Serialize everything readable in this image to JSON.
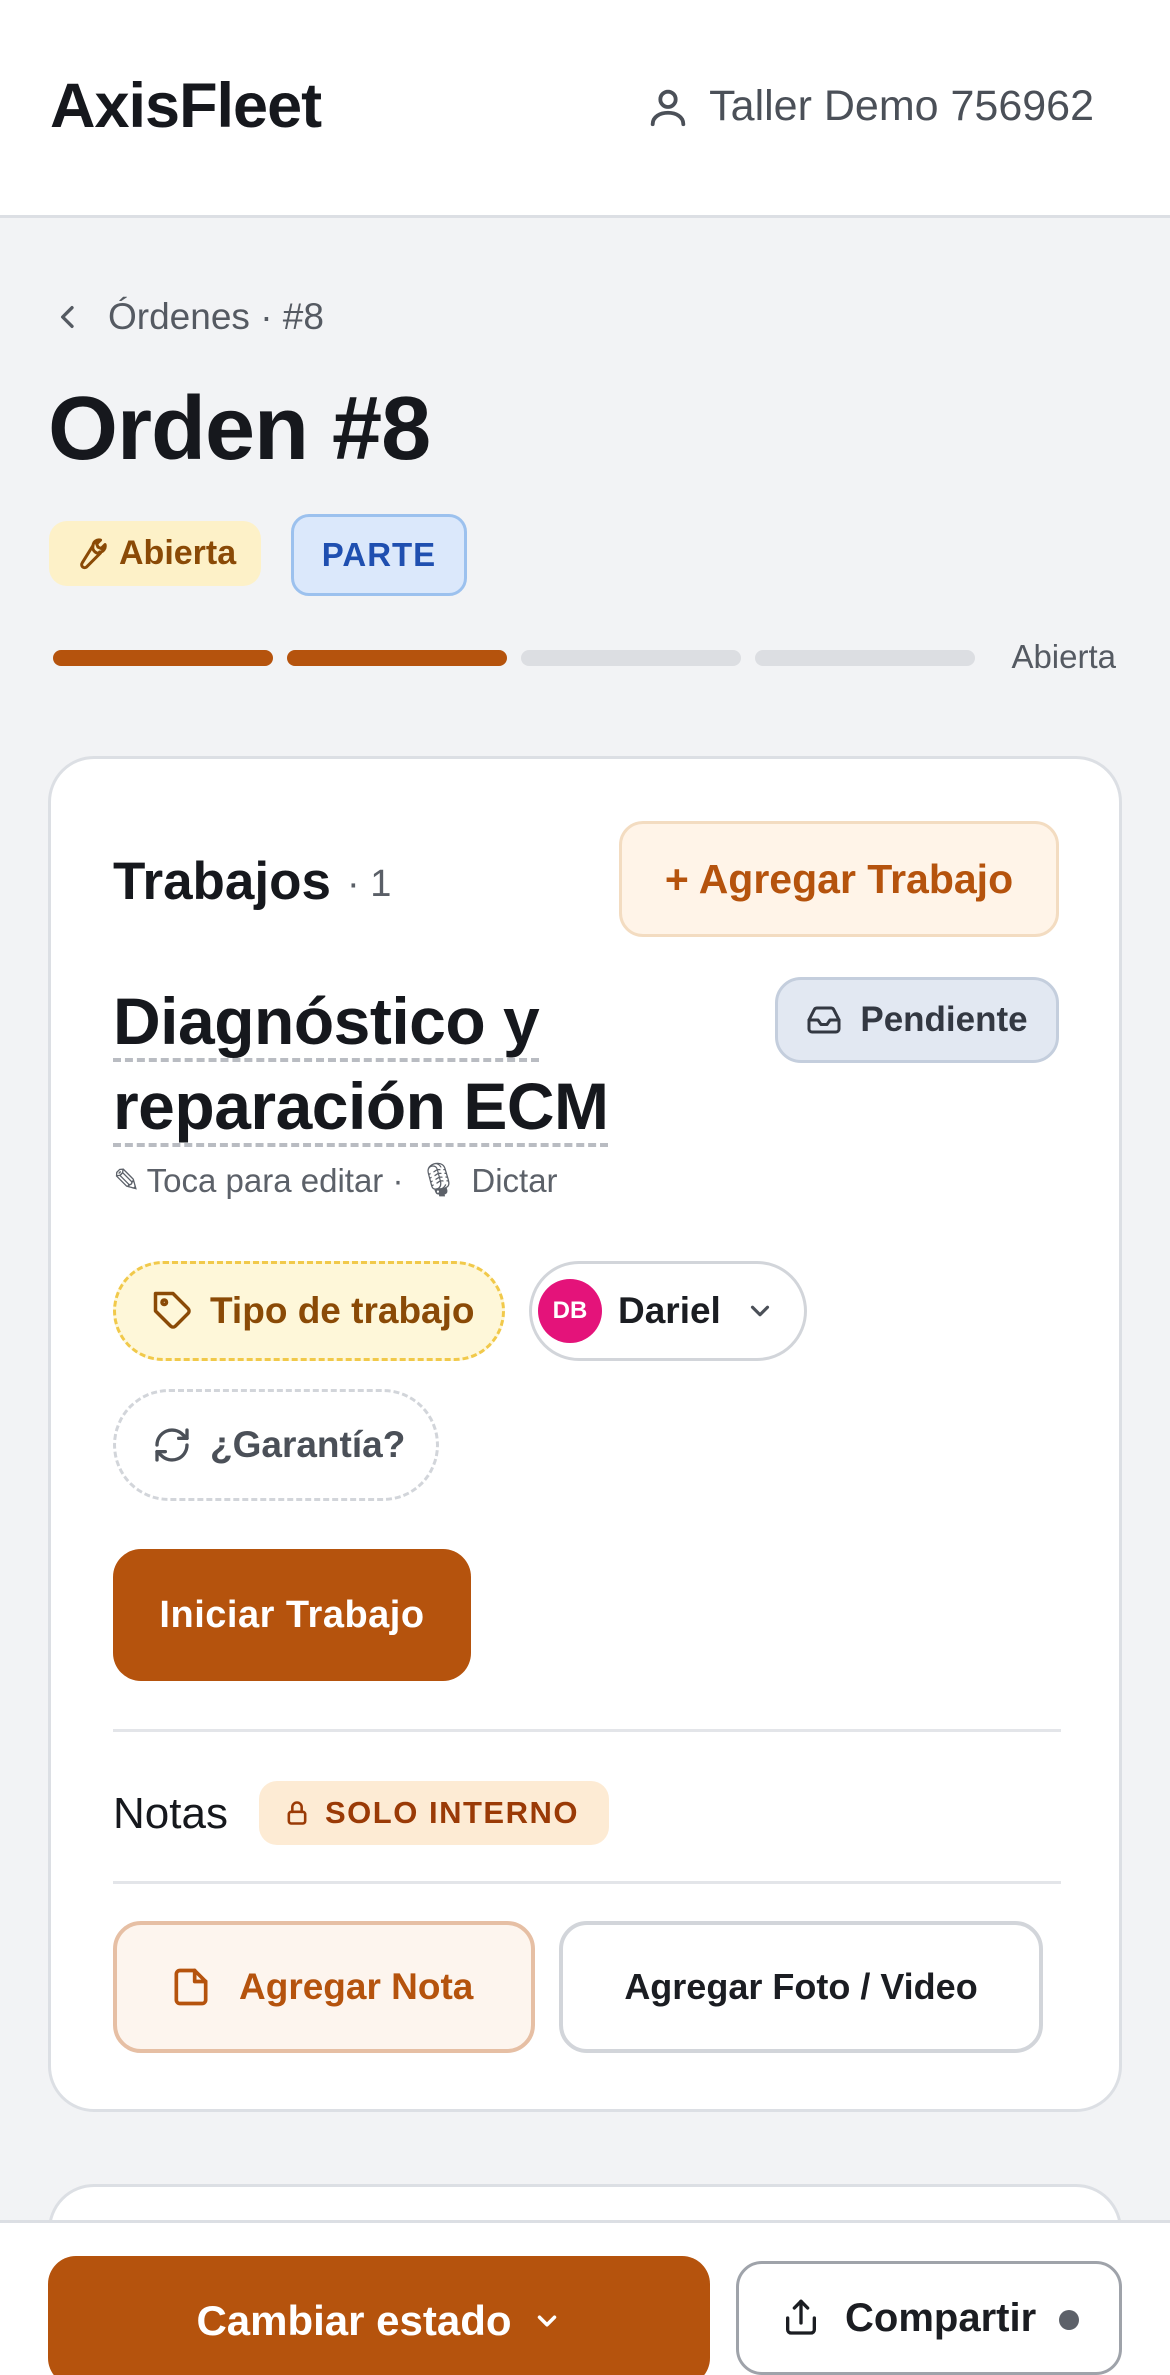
{
  "header": {
    "brand": "AxisFleet",
    "user_name": "Taller Demo 756962"
  },
  "breadcrumb": {
    "text": "Órdenes · #8"
  },
  "page_title": "Orden #8",
  "badges": {
    "status": "Abierta",
    "type": "PARTE"
  },
  "progress": {
    "label": "Abierta",
    "completed_steps": 2,
    "total_steps": 4
  },
  "jobs": {
    "title": "Trabajos",
    "count": "· 1",
    "add_button": "+ Agregar Trabajo",
    "job": {
      "title_line1": "Diagnóstico y",
      "title_line2": "reparación ECM",
      "status": "Pendiente",
      "edit_hint": "Toca para editar ·",
      "dictate_label": "Dictar",
      "work_type_chip": "Tipo de trabajo",
      "assignee_initials": "DB",
      "assignee_name": "Dariel",
      "warranty_chip": "¿Garantía?",
      "start_button": "Iniciar Trabajo"
    },
    "notes": {
      "title": "Notas",
      "internal_badge": "SOLO INTERNO",
      "add_note_button": "Agregar Nota",
      "add_media_button": "Agregar Foto / Video"
    }
  },
  "bottom_bar": {
    "change_status_button": "Cambiar estado",
    "share_button": "Compartir"
  },
  "colors": {
    "accent": "#b5530d",
    "avatar": "#e4137a",
    "badge_blue": "#1f4fb0"
  }
}
